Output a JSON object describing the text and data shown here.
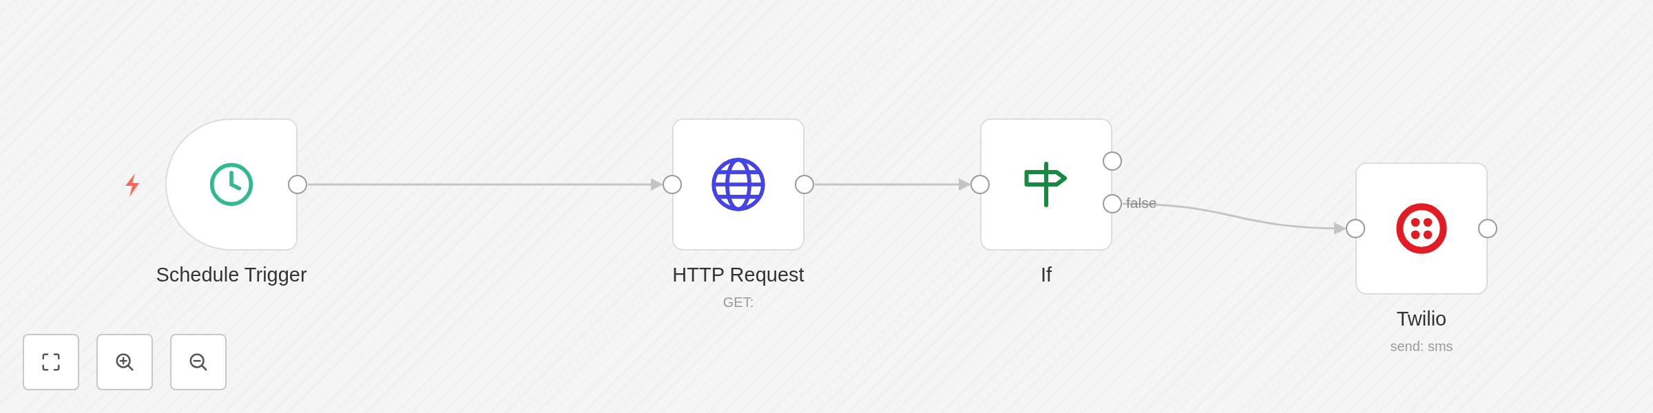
{
  "canvas": {
    "nodes": [
      {
        "name": "Schedule Trigger",
        "kind": "trigger"
      },
      {
        "name": "HTTP Request",
        "subtitle": "GET:",
        "kind": "action"
      },
      {
        "name": "If",
        "kind": "condition",
        "branch_label": "false"
      },
      {
        "name": "Twilio",
        "subtitle": "send: sms",
        "kind": "action"
      }
    ]
  },
  "zoom_controls": [
    {
      "kind": "fit"
    },
    {
      "kind": "zoom_in"
    },
    {
      "kind": "zoom_out"
    }
  ]
}
